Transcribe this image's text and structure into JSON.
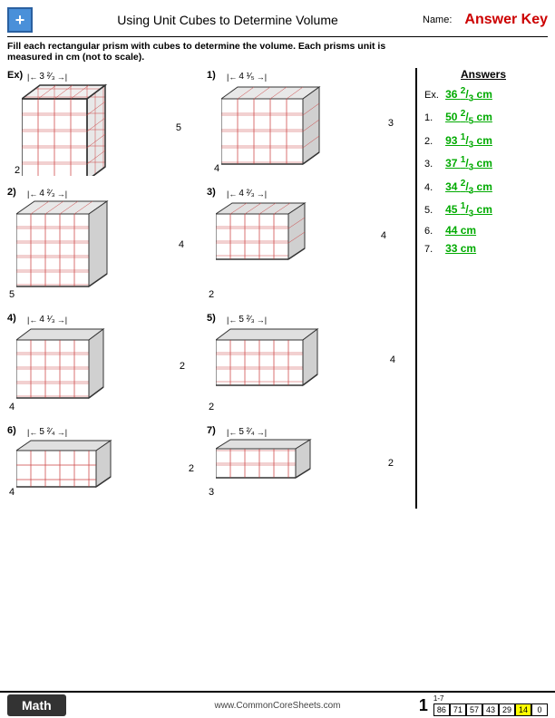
{
  "header": {
    "title": "Using Unit Cubes to Determine Volume",
    "name_label": "Name:",
    "answer_key": "Answer Key"
  },
  "instructions": {
    "text": "Fill each rectangular prism with cubes to determine the volume. Each prisms unit is measured in cm (not to scale)."
  },
  "answers": {
    "title": "Answers",
    "items": [
      {
        "label": "Ex.",
        "value": "36 ²⁄₃ cm"
      },
      {
        "label": "1.",
        "value": "50 ²⁄₅ cm"
      },
      {
        "label": "2.",
        "value": "93 ¹⁄₃ cm"
      },
      {
        "label": "3.",
        "value": "37 ¹⁄₃ cm"
      },
      {
        "label": "4.",
        "value": "34 ²⁄₃ cm"
      },
      {
        "label": "5.",
        "value": "45 ¹⁄₃ cm"
      },
      {
        "label": "6.",
        "value": "44 cm"
      },
      {
        "label": "7.",
        "value": "33 cm"
      }
    ]
  },
  "example": {
    "dim_top": "3 ²⁄₃",
    "dim_right": "5",
    "dim_bottom": "2"
  },
  "problem1": {
    "number": "1)",
    "dim_top": "4 ¹⁄₅",
    "dim_right": "3",
    "dim_bottom": "4"
  },
  "problem2": {
    "number": "2)",
    "dim_top": "4 ²⁄₃",
    "dim_right": "4",
    "dim_bottom": "5"
  },
  "problem3": {
    "number": "3)",
    "dim_top": "4 ²⁄₃",
    "dim_right": "4",
    "dim_bottom": "2"
  },
  "problem4": {
    "number": "4)",
    "dim_top": "4 ¹⁄₃",
    "dim_right": "2",
    "dim_bottom": "4"
  },
  "problem5": {
    "number": "5)",
    "dim_top": "5 ²⁄₃",
    "dim_right": "4",
    "dim_bottom": "2"
  },
  "problem6": {
    "number": "6)",
    "dim_top": "5 ²⁄₄",
    "dim_right": "2",
    "dim_bottom": "4"
  },
  "problem7": {
    "number": "7)",
    "dim_top": "5 ²⁄₄",
    "dim_right": "2",
    "dim_bottom": "3"
  },
  "footer": {
    "math_label": "Math",
    "url": "www.CommonCoreSheets.com",
    "page": "1",
    "score_range": "1-7",
    "scores": [
      "86",
      "71",
      "57",
      "43",
      "29",
      "14",
      "0"
    ]
  }
}
